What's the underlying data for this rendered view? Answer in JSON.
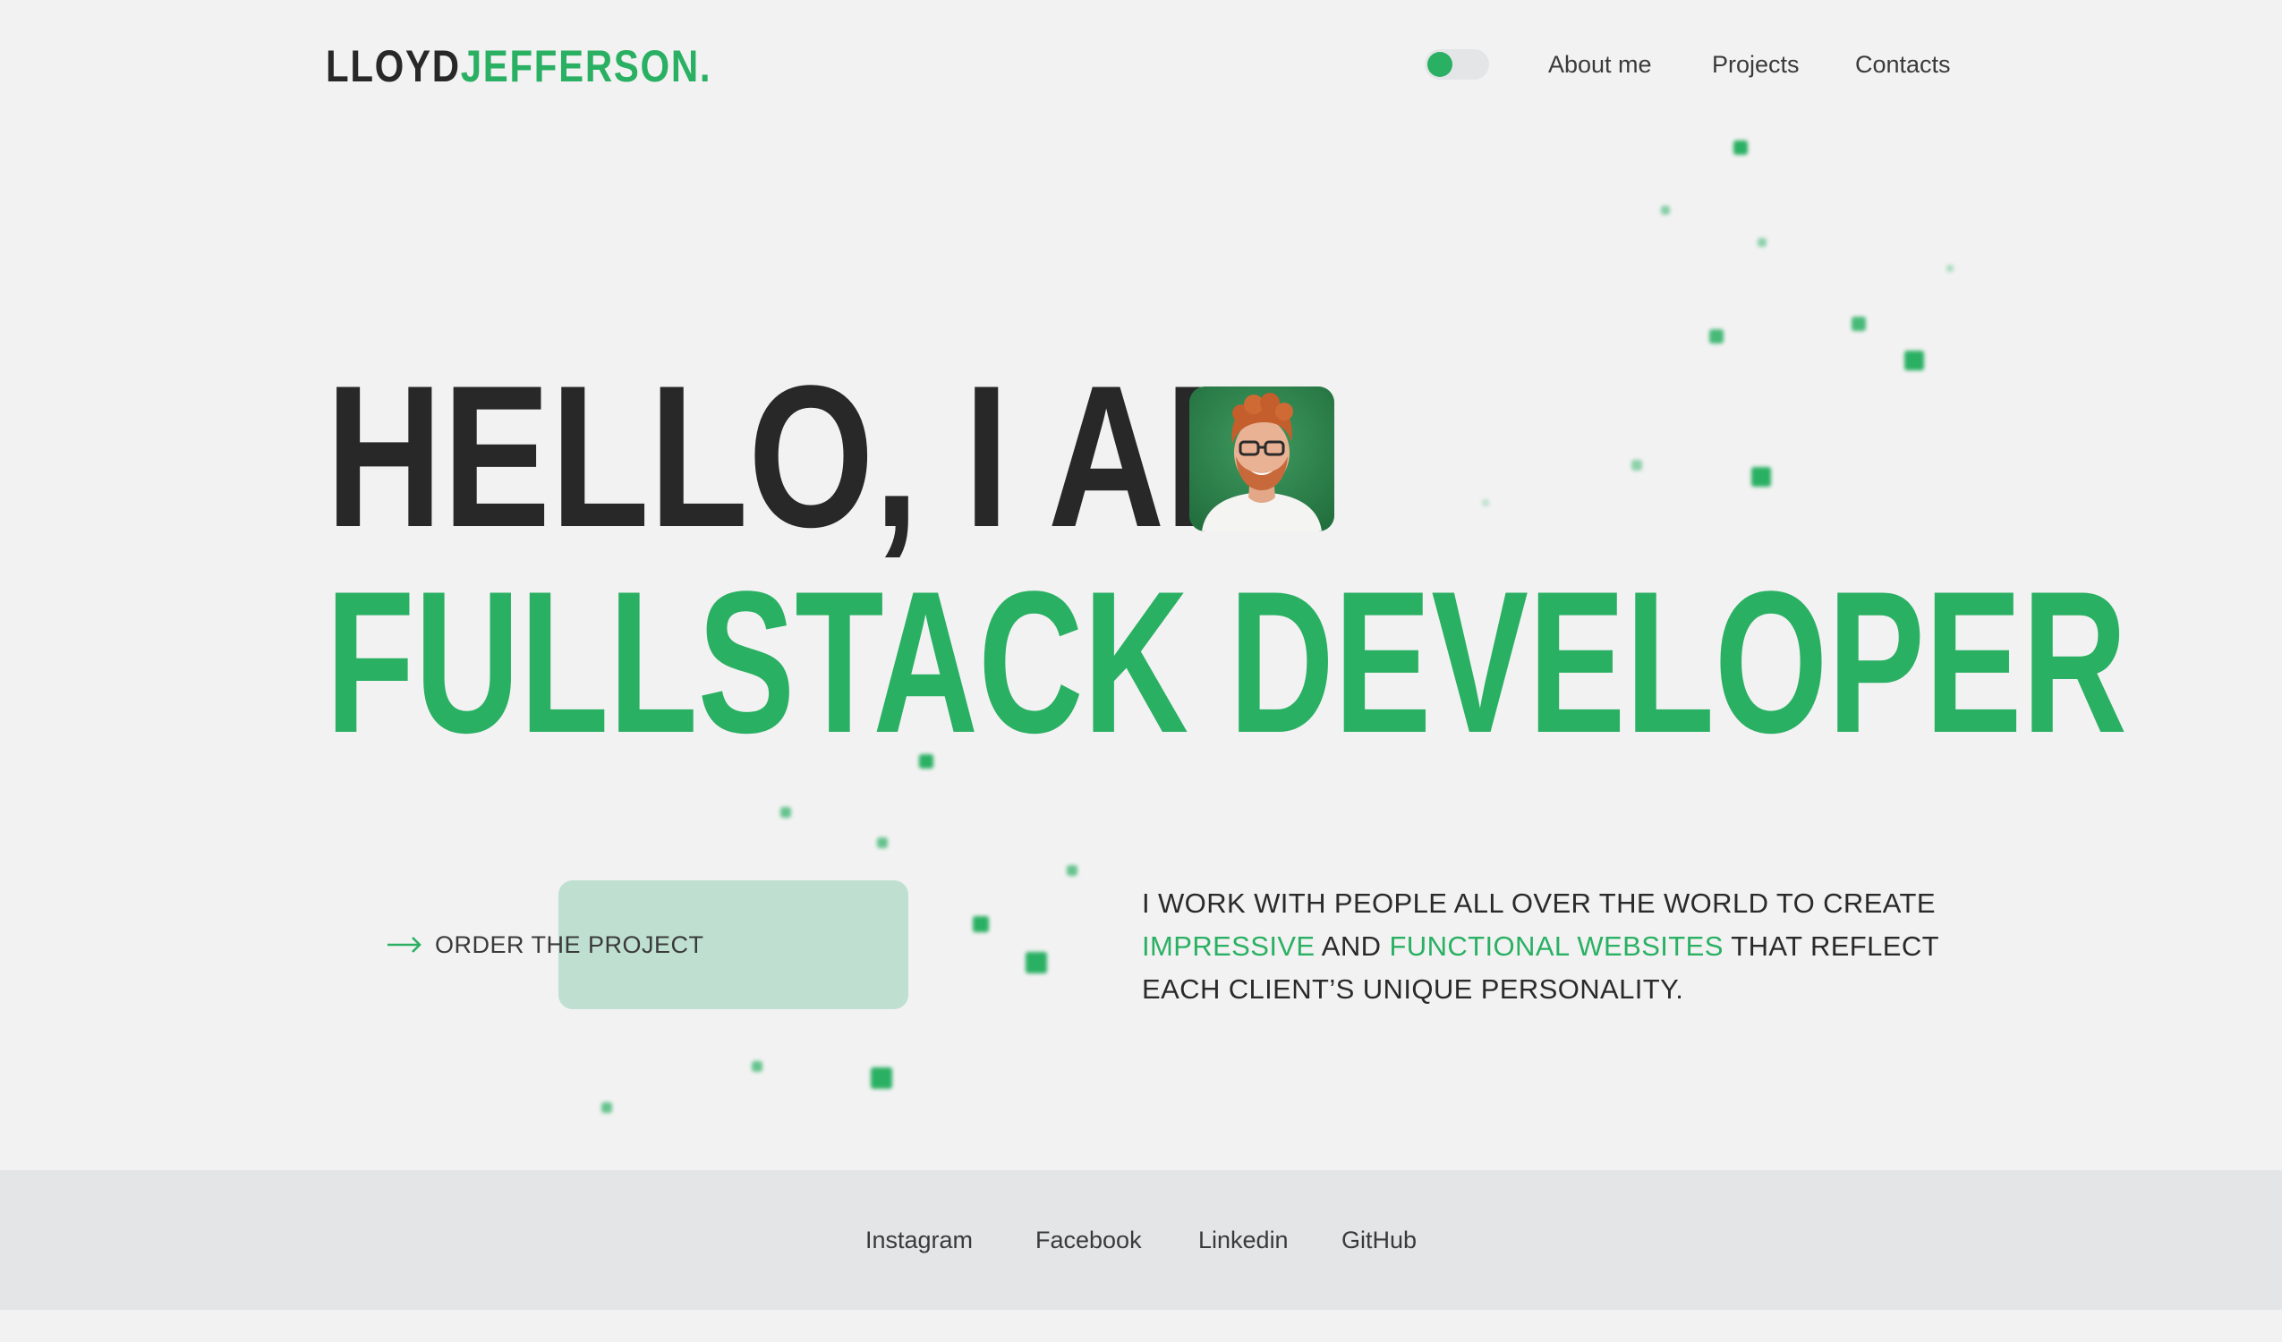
{
  "header": {
    "logo_first": "LLOYD",
    "logo_last": "JEFFERSON.",
    "nav": [
      {
        "label": "About me"
      },
      {
        "label": "Projects"
      },
      {
        "label": "Contacts"
      }
    ]
  },
  "hero": {
    "line1": "HELLO, I AM",
    "line2": "FULLSTACK DEVELOPER",
    "cta_label": "ORDER THE PROJECT",
    "intro": {
      "part1": "I WORK WITH PEOPLE ALL OVER THE WORLD TO CREATE ",
      "accent1": "IMPRESSIVE",
      "part2": " AND ",
      "accent2": "FUNCTIONAL WEBSITES",
      "part3": " THAT REFLECT EACH CLIENT’S UNIQUE PERSONALITY."
    }
  },
  "footer": {
    "links": [
      {
        "label": "Instagram"
      },
      {
        "label": "Facebook"
      },
      {
        "label": "Linkedin"
      },
      {
        "label": "GitHub"
      }
    ]
  },
  "theme": {
    "accent": "#2ab063",
    "dark": "#282828",
    "background": "#f2f2f2",
    "footer_background": "#e4e5e7",
    "cta_highlight": "#bfe0d1"
  },
  "icons": {
    "theme_toggle": "toggle-switch",
    "cta": "arrow-right-icon",
    "avatar": "profile-photo"
  }
}
